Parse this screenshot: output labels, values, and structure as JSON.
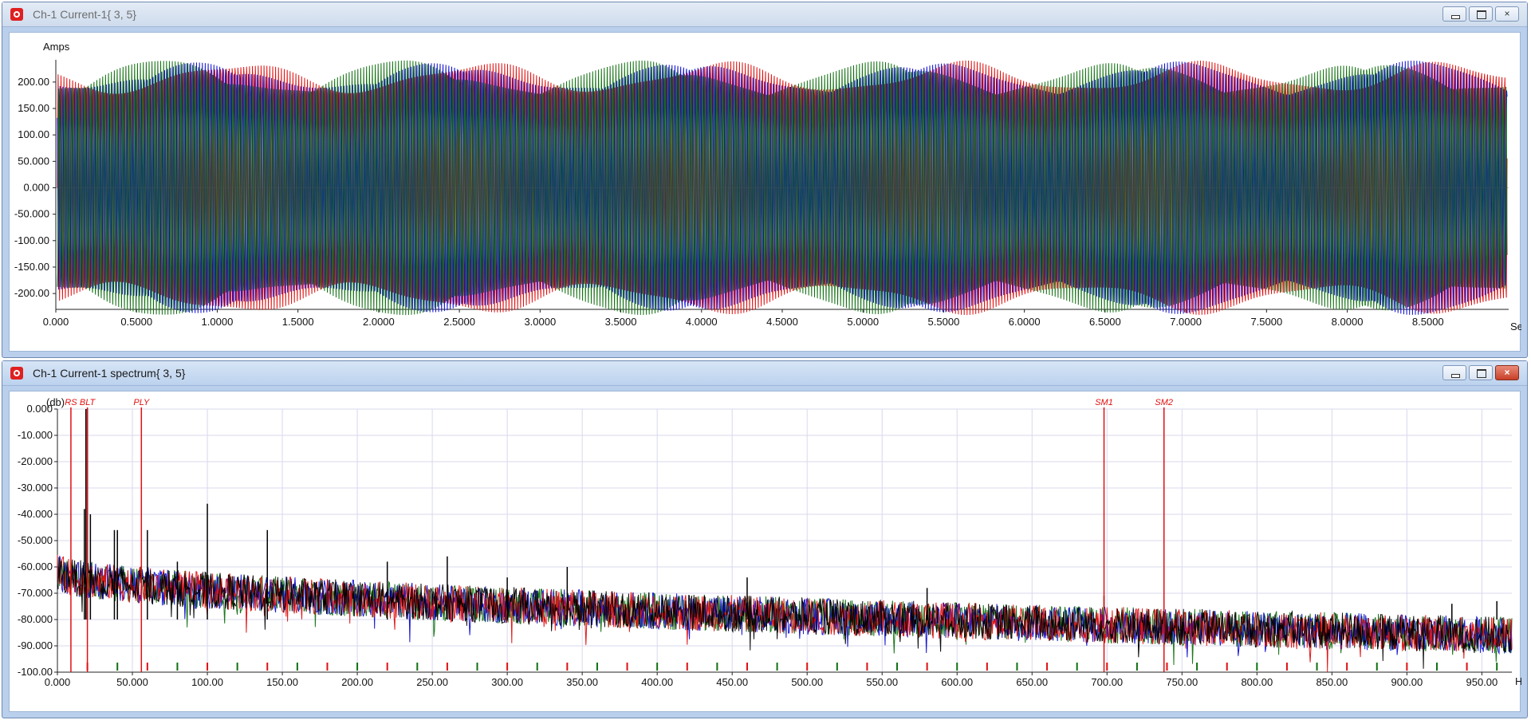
{
  "windows": [
    {
      "id": "top",
      "title": "Ch-1 Current-1{ 3, 5}",
      "controls": {
        "minimize": "minimize",
        "restore": "restore",
        "close": "×"
      }
    },
    {
      "id": "bottom",
      "title": "Ch-1 Current-1 spectrum{ 3, 5}",
      "controls": {
        "minimize": "minimize",
        "restore": "restore",
        "close": "×"
      }
    }
  ],
  "chart_data": [
    {
      "type": "line",
      "ylabel": "Amps",
      "xlabel": "Sec",
      "ylim": [
        -230,
        230
      ],
      "xlim": [
        0,
        9.0
      ],
      "y_ticks": [
        "200.00",
        "150.00",
        "100.00",
        "50.000",
        "0.000",
        "-50.000",
        "-100.00",
        "-150.00",
        "-200.00"
      ],
      "y_tick_values": [
        200,
        150,
        100,
        50,
        0,
        -50,
        -100,
        -150,
        -200
      ],
      "x_ticks": [
        "0.000",
        "0.5000",
        "1.0000",
        "1.5000",
        "2.0000",
        "2.5000",
        "3.0000",
        "3.5000",
        "4.0000",
        "4.5000",
        "5.0000",
        "5.5000",
        "6.0000",
        "6.5000",
        "7.0000",
        "7.5000",
        "8.0000",
        "8.5000"
      ],
      "x_tick_values": [
        0,
        0.5,
        1.0,
        1.5,
        2.0,
        2.5,
        3.0,
        3.5,
        4.0,
        4.5,
        5.0,
        5.5,
        6.0,
        6.5,
        7.0,
        7.5,
        8.0,
        8.5
      ],
      "grid": false,
      "series_colors": [
        "#e01010",
        "#1010d0",
        "#107010"
      ],
      "amplitude": 215,
      "cycles": 500
    },
    {
      "type": "line",
      "ylabel": "(db)",
      "xlabel": "Hz",
      "ylim": [
        -100,
        0
      ],
      "xlim": [
        0,
        970
      ],
      "y_ticks": [
        "0.000",
        "-10.000",
        "-20.000",
        "-30.000",
        "-40.000",
        "-50.000",
        "-60.000",
        "-70.000",
        "-80.000",
        "-90.000",
        "-100.00"
      ],
      "y_tick_values": [
        0,
        -10,
        -20,
        -30,
        -40,
        -50,
        -60,
        -70,
        -80,
        -90,
        -100
      ],
      "x_ticks": [
        "0.000",
        "50.000",
        "100.00",
        "150.00",
        "200.00",
        "250.00",
        "300.00",
        "350.00",
        "400.00",
        "450.00",
        "500.00",
        "550.00",
        "600.00",
        "650.00",
        "700.00",
        "750.00",
        "800.00",
        "850.00",
        "900.00",
        "950.00"
      ],
      "x_tick_values": [
        0,
        50,
        100,
        150,
        200,
        250,
        300,
        350,
        400,
        450,
        500,
        550,
        600,
        650,
        700,
        750,
        800,
        850,
        900,
        950
      ],
      "grid": true,
      "series_colors": [
        "#e01010",
        "#1010d0",
        "#107010",
        "#000000"
      ],
      "markers": [
        {
          "label": "RS",
          "x": 9
        },
        {
          "label": "BLT",
          "x": 20
        },
        {
          "label": "PLY",
          "x": 56
        },
        {
          "label": "SM1",
          "x": 698
        },
        {
          "label": "SM2",
          "x": 738
        }
      ],
      "peaks": [
        {
          "x": 19,
          "y": 0
        },
        {
          "x": 20,
          "y": 0
        },
        {
          "x": 18,
          "y": -38
        },
        {
          "x": 22,
          "y": -40
        },
        {
          "x": 38,
          "y": -46
        },
        {
          "x": 40,
          "y": -46
        },
        {
          "x": 60,
          "y": -46
        },
        {
          "x": 80,
          "y": -58
        },
        {
          "x": 100,
          "y": -36
        },
        {
          "x": 140,
          "y": -46
        },
        {
          "x": 220,
          "y": -58
        },
        {
          "x": 260,
          "y": -56
        },
        {
          "x": 340,
          "y": -60
        },
        {
          "x": 300,
          "y": -64
        },
        {
          "x": 460,
          "y": -64
        },
        {
          "x": 580,
          "y": -68
        },
        {
          "x": 698,
          "y": -71
        },
        {
          "x": 960,
          "y": -73
        },
        {
          "x": 930,
          "y": -74
        }
      ],
      "noise_floor_start": -62,
      "noise_floor_end": -86
    }
  ]
}
